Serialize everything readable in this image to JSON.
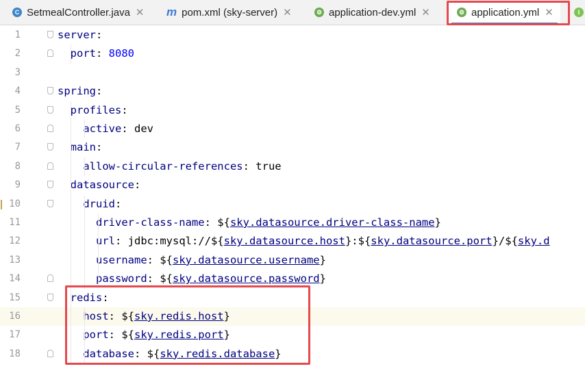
{
  "tabs": [
    {
      "label": "SetmealController.java",
      "icon": "class-c-icon",
      "active": false
    },
    {
      "label": "pom.xml (sky-server)",
      "icon": "maven-m-icon",
      "active": false
    },
    {
      "label": "application-dev.yml",
      "icon": "spring-yaml-icon",
      "active": false
    },
    {
      "label": "application.yml",
      "icon": "spring-yaml-icon",
      "active": true
    }
  ],
  "tab_icons": {
    "c": "C",
    "m": "m",
    "i": "I"
  },
  "colors": {
    "key": "#000080",
    "number": "#0000ff",
    "highlight": "#e5484d",
    "current_line": "#fcfaed"
  },
  "editor": {
    "lines": [
      {
        "n": "1",
        "parts": [
          {
            "t": "server",
            "c": "k"
          },
          {
            "t": ":",
            "c": "plain"
          }
        ]
      },
      {
        "n": "2",
        "parts": [
          {
            "t": "  port",
            "c": "k"
          },
          {
            "t": ": ",
            "c": "plain"
          },
          {
            "t": "8080",
            "c": "v"
          }
        ]
      },
      {
        "n": "3",
        "parts": []
      },
      {
        "n": "4",
        "parts": [
          {
            "t": "spring",
            "c": "k"
          },
          {
            "t": ":",
            "c": "plain"
          }
        ]
      },
      {
        "n": "5",
        "parts": [
          {
            "t": "  profiles",
            "c": "k"
          },
          {
            "t": ":",
            "c": "plain"
          }
        ]
      },
      {
        "n": "6",
        "parts": [
          {
            "t": "    active",
            "c": "k"
          },
          {
            "t": ": dev",
            "c": "plain"
          }
        ]
      },
      {
        "n": "7",
        "parts": [
          {
            "t": "  main",
            "c": "k"
          },
          {
            "t": ":",
            "c": "plain"
          }
        ]
      },
      {
        "n": "8",
        "parts": [
          {
            "t": "    allow-circular-references",
            "c": "k"
          },
          {
            "t": ": true",
            "c": "plain"
          }
        ]
      },
      {
        "n": "9",
        "parts": [
          {
            "t": "  datasource",
            "c": "k"
          },
          {
            "t": ":",
            "c": "plain"
          }
        ]
      },
      {
        "n": "10",
        "parts": [
          {
            "t": "    druid",
            "c": "k"
          },
          {
            "t": ":",
            "c": "plain"
          }
        ]
      },
      {
        "n": "11",
        "parts": [
          {
            "t": "      driver-class-name",
            "c": "k"
          },
          {
            "t": ": ${",
            "c": "plain"
          },
          {
            "t": "sky.datasource.driver-class-name",
            "c": "ref"
          },
          {
            "t": "}",
            "c": "plain"
          }
        ]
      },
      {
        "n": "12",
        "parts": [
          {
            "t": "      url",
            "c": "k"
          },
          {
            "t": ": jdbc:mysql://${",
            "c": "plain"
          },
          {
            "t": "sky.datasource.host",
            "c": "ref"
          },
          {
            "t": "}:${",
            "c": "plain"
          },
          {
            "t": "sky.datasource.port",
            "c": "ref"
          },
          {
            "t": "}/${",
            "c": "plain"
          },
          {
            "t": "sky.d",
            "c": "ref"
          }
        ]
      },
      {
        "n": "13",
        "parts": [
          {
            "t": "      username",
            "c": "k"
          },
          {
            "t": ": ${",
            "c": "plain"
          },
          {
            "t": "sky.datasource.username",
            "c": "ref"
          },
          {
            "t": "}",
            "c": "plain"
          }
        ]
      },
      {
        "n": "14",
        "parts": [
          {
            "t": "      password",
            "c": "k"
          },
          {
            "t": ": ${",
            "c": "plain"
          },
          {
            "t": "sky.datasource.password",
            "c": "ref"
          },
          {
            "t": "}",
            "c": "plain"
          }
        ]
      },
      {
        "n": "15",
        "parts": [
          {
            "t": "  redis",
            "c": "k"
          },
          {
            "t": ":",
            "c": "plain"
          }
        ]
      },
      {
        "n": "16",
        "parts": [
          {
            "t": "    host",
            "c": "k"
          },
          {
            "t": ": ${",
            "c": "plain"
          },
          {
            "t": "sky.redis.host",
            "c": "ref"
          },
          {
            "t": "}",
            "c": "plain"
          }
        ]
      },
      {
        "n": "17",
        "parts": [
          {
            "t": "    port",
            "c": "k"
          },
          {
            "t": ": ${",
            "c": "plain"
          },
          {
            "t": "sky.redis.port",
            "c": "ref"
          },
          {
            "t": "}",
            "c": "plain"
          }
        ]
      },
      {
        "n": "18",
        "parts": [
          {
            "t": "    database",
            "c": "k"
          },
          {
            "t": ": ${",
            "c": "plain"
          },
          {
            "t": "sky.redis.database",
            "c": "ref"
          },
          {
            "t": "}",
            "c": "plain"
          }
        ]
      }
    ]
  }
}
